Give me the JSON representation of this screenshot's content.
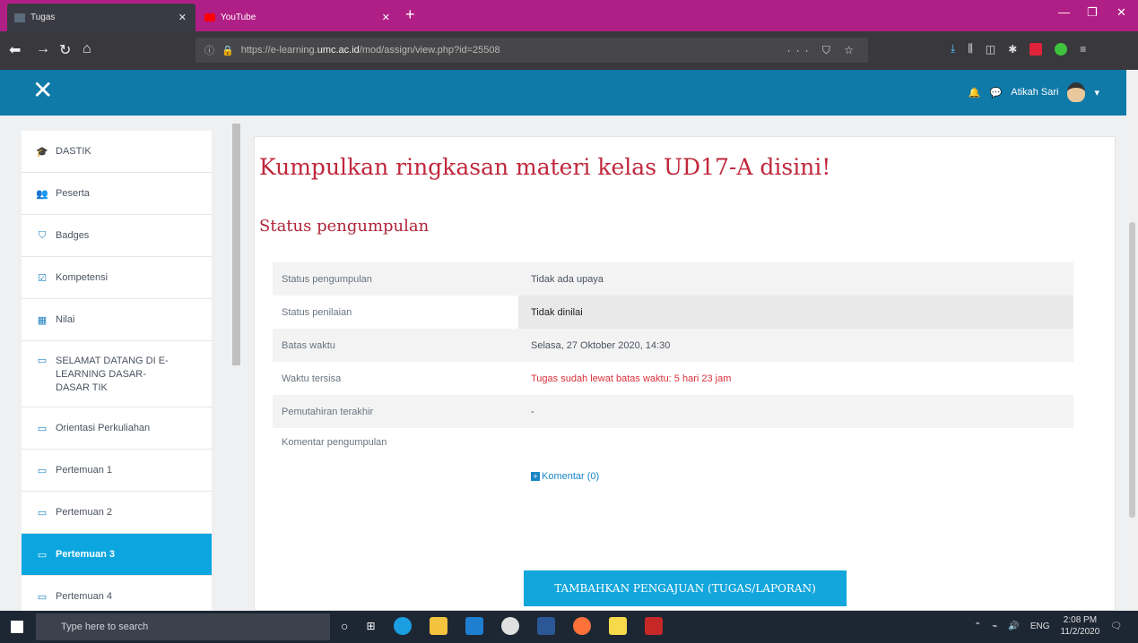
{
  "browser": {
    "tabs": [
      {
        "label": "Tugas"
      },
      {
        "label": "YouTube"
      }
    ],
    "url": {
      "prefix": "https://e-learning.",
      "domain": "umc.ac.id",
      "path": "/mod/assign/view.php?id=25508"
    }
  },
  "app": {
    "user_name": "Atikah Sari"
  },
  "sidebar": {
    "items": [
      {
        "label": "DASTIK",
        "icon": "graduation-cap-icon",
        "glyph": "🎓"
      },
      {
        "label": "Peserta",
        "icon": "users-icon",
        "glyph": "👥"
      },
      {
        "label": "Badges",
        "icon": "shield-icon",
        "glyph": "⛉"
      },
      {
        "label": "Kompetensi",
        "icon": "checklist-icon",
        "glyph": "☑"
      },
      {
        "label": "Nilai",
        "icon": "table-icon",
        "glyph": "▦"
      },
      {
        "label": "SELAMAT DATANG DI E-LEARNING DASAR-DASAR TIK",
        "icon": "folder-icon",
        "glyph": "▭"
      },
      {
        "label": "Orientasi Perkuliahan",
        "icon": "folder-icon",
        "glyph": "▭"
      },
      {
        "label": "Pertemuan 1",
        "icon": "folder-icon",
        "glyph": "▭"
      },
      {
        "label": "Pertemuan 2",
        "icon": "folder-icon",
        "glyph": "▭"
      },
      {
        "label": "Pertemuan 3",
        "icon": "folder-icon",
        "glyph": "▭"
      },
      {
        "label": "Pertemuan 4",
        "icon": "folder-icon",
        "glyph": "▭"
      }
    ]
  },
  "main": {
    "title": "Kumpulkan ringkasan materi kelas UD17-A disini!",
    "section_title": "Status pengumpulan",
    "rows": [
      {
        "key": "Status pengumpulan",
        "value": "Tidak ada upaya"
      },
      {
        "key": "Status penilaian",
        "value": "Tidak dinilai"
      },
      {
        "key": "Batas waktu",
        "value": "Selasa, 27 Oktober 2020, 14:30"
      },
      {
        "key": "Waktu tersisa",
        "value": "Tugas sudah lewat batas waktu: 5 hari 23 jam"
      },
      {
        "key": "Pemutahiran terakhir",
        "value": "-"
      },
      {
        "key": "Komentar pengumpulan",
        "value": "Komentar (0)"
      }
    ],
    "submit_label": "TAMBAHKAN PENGAJUAN (TUGAS/LAPORAN)"
  },
  "taskbar": {
    "search_placeholder": "Type here to search",
    "lang": "ENG",
    "time": "2:08 PM",
    "date": "11/2/2020"
  },
  "colors": {
    "tabstrip": "#b01f86",
    "appbar": "#0f79a8",
    "accent": "#0ba6e0",
    "title_red": "#c0273b"
  }
}
